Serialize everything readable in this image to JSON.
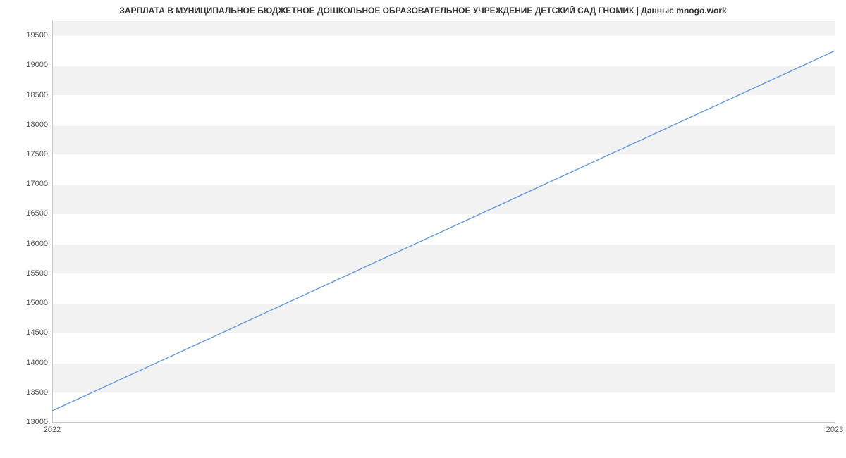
{
  "chart_data": {
    "type": "line",
    "title": "ЗАРПЛАТА В МУНИЦИПАЛЬНОЕ БЮДЖЕТНОЕ  ДОШКОЛЬНОЕ ОБРАЗОВАТЕЛЬНОЕ УЧРЕЖДЕНИЕ ДЕТСКИЙ САД ГНОМИК | Данные mnogo.work",
    "x": [
      2022,
      2023
    ],
    "values": [
      13200,
      19250
    ],
    "x_ticks": [
      "2022",
      "2023"
    ],
    "y_ticks": [
      13000,
      13500,
      14000,
      14500,
      15000,
      15500,
      16000,
      16500,
      17000,
      17500,
      18000,
      18500,
      19000,
      19500
    ],
    "xlim": [
      2022,
      2023
    ],
    "ylim": [
      13000,
      19750
    ],
    "xlabel": "",
    "ylabel": "",
    "series_color": "#6f9edb",
    "band_color": "#f2f2f2"
  }
}
